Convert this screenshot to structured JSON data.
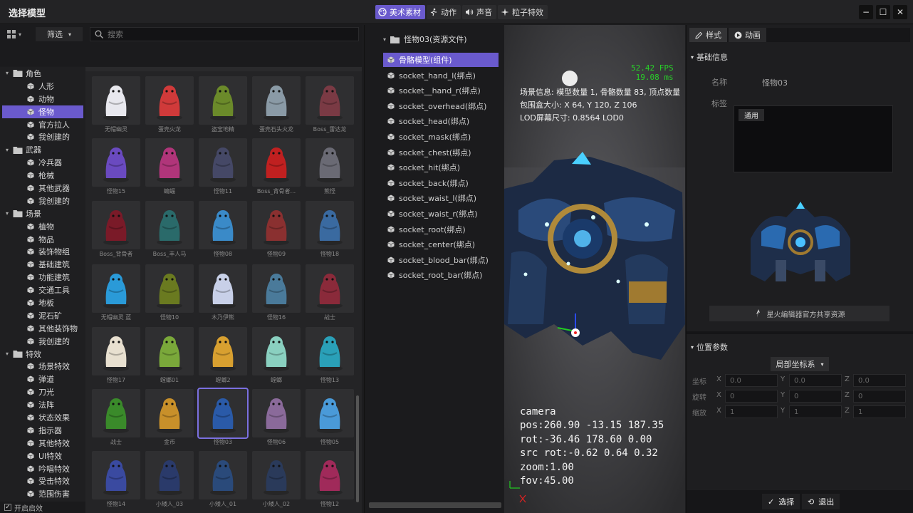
{
  "app": {
    "title": "选择模型"
  },
  "modes": [
    {
      "label": "美术素材",
      "icon": "palette-icon",
      "active": true
    },
    {
      "label": "动作",
      "icon": "running-icon",
      "active": false
    },
    {
      "label": "声音",
      "icon": "speaker-icon",
      "active": false
    },
    {
      "label": "粒子特效",
      "icon": "sparkle-icon",
      "active": false
    }
  ],
  "window_buttons": {
    "minimize": "−",
    "maximize": "☐",
    "close": "✕"
  },
  "toolbar": {
    "filter_label": "筛选",
    "search_placeholder": "搜索"
  },
  "tree": [
    {
      "label": "角色",
      "level": 0
    },
    {
      "label": "人形",
      "level": 1
    },
    {
      "label": "动物",
      "level": 1
    },
    {
      "label": "怪物",
      "level": 1,
      "selected": true
    },
    {
      "label": "官方拉人",
      "level": 1
    },
    {
      "label": "我创建的",
      "level": 1
    },
    {
      "label": "武器",
      "level": 0
    },
    {
      "label": "冷兵器",
      "level": 1
    },
    {
      "label": "枪械",
      "level": 1
    },
    {
      "label": "其他武器",
      "level": 1
    },
    {
      "label": "我创建的",
      "level": 1
    },
    {
      "label": "场景",
      "level": 0
    },
    {
      "label": "植物",
      "level": 1
    },
    {
      "label": "物品",
      "level": 1
    },
    {
      "label": "装饰物组",
      "level": 1
    },
    {
      "label": "基础建筑",
      "level": 1
    },
    {
      "label": "功能建筑",
      "level": 1
    },
    {
      "label": "交通工具",
      "level": 1
    },
    {
      "label": "地板",
      "level": 1
    },
    {
      "label": "泥石矿",
      "level": 1
    },
    {
      "label": "其他装饰物",
      "level": 1
    },
    {
      "label": "我创建的",
      "level": 1
    },
    {
      "label": "特效",
      "level": 0
    },
    {
      "label": "场景特效",
      "level": 1
    },
    {
      "label": "弹道",
      "level": 1
    },
    {
      "label": "刀光",
      "level": 1
    },
    {
      "label": "法阵",
      "level": 1
    },
    {
      "label": "状态效果",
      "level": 1
    },
    {
      "label": "指示器",
      "level": 1
    },
    {
      "label": "其他特效",
      "level": 1
    },
    {
      "label": "UI特效",
      "level": 1
    },
    {
      "label": "吟唱特效",
      "level": 1
    },
    {
      "label": "受击特效",
      "level": 1
    },
    {
      "label": "范围伤害",
      "level": 1
    }
  ],
  "startup": {
    "label": "开启启效",
    "checked": "✓"
  },
  "assets": [
    {
      "name": "无帽幽灵",
      "color": "#e8e8ee"
    },
    {
      "name": "蛋壳火龙",
      "color": "#d03a3a"
    },
    {
      "name": "盗宝地精",
      "color": "#6b8a2a"
    },
    {
      "name": "蛋壳石头火龙",
      "color": "#8a9aa6"
    },
    {
      "name": "Boss_雷达龙",
      "color": "#7a3a44"
    },
    {
      "name": "怪物15",
      "color": "#6a4ac0"
    },
    {
      "name": "蝙蝠",
      "color": "#b0357a"
    },
    {
      "name": "怪物11",
      "color": "#454866"
    },
    {
      "name": "Boss_背骨者...",
      "color": "#c02020"
    },
    {
      "name": "熊怪",
      "color": "#6a6a74"
    },
    {
      "name": "Boss_背骨者",
      "color": "#7a1a28"
    },
    {
      "name": "Boss_丰人马",
      "color": "#2a6a6a"
    },
    {
      "name": "怪物08",
      "color": "#3a8ac8"
    },
    {
      "name": "怪物09",
      "color": "#8a3030"
    },
    {
      "name": "怪物18",
      "color": "#3a6aa0"
    },
    {
      "name": "无帽幽灵 蓝",
      "color": "#2a9ad8"
    },
    {
      "name": "怪物10",
      "color": "#6a7a20"
    },
    {
      "name": "木乃伊熊",
      "color": "#c8d0e8"
    },
    {
      "name": "怪物16",
      "color": "#4a7a9a"
    },
    {
      "name": "战士",
      "color": "#8a2a3a"
    },
    {
      "name": "怪物17",
      "color": "#e8e0d0"
    },
    {
      "name": "螳螂01",
      "color": "#7aa83a"
    },
    {
      "name": "螳螂2",
      "color": "#d8a030"
    },
    {
      "name": "螳螂",
      "color": "#8ad0c0"
    },
    {
      "name": "怪物13",
      "color": "#2aa0b8"
    },
    {
      "name": "战士",
      "color": "#3a8a2a"
    },
    {
      "name": "金币",
      "color": "#c8902a"
    },
    {
      "name": "怪物03",
      "color": "#2a5aa8",
      "selected": true
    },
    {
      "name": "怪物06",
      "color": "#8a6a9a"
    },
    {
      "name": "怪物05",
      "color": "#4a9ad8"
    },
    {
      "name": "怪物14",
      "color": "#3a4aa0"
    },
    {
      "name": "小矮人_03",
      "color": "#2a3a6a"
    },
    {
      "name": "小矮人_01",
      "color": "#2a4a7a"
    },
    {
      "name": "小矮人_02",
      "color": "#2a3a5a"
    },
    {
      "name": "怪物12",
      "color": "#a02a5a"
    }
  ],
  "hierarchy": {
    "root": "怪物03(资源文件)",
    "items": [
      {
        "label": "骨骼模型(组件)",
        "selected": true
      },
      {
        "label": "socket_hand_l(绑点)"
      },
      {
        "label": "socket__hand_r(绑点)"
      },
      {
        "label": "socket_overhead(绑点)"
      },
      {
        "label": "socket_head(绑点)"
      },
      {
        "label": "socket_mask(绑点)"
      },
      {
        "label": "socket_chest(绑点)"
      },
      {
        "label": "socket_hit(绑点)"
      },
      {
        "label": "socket_back(绑点)"
      },
      {
        "label": "socket_waist_l(绑点)"
      },
      {
        "label": "socket_waist_r(绑点)"
      },
      {
        "label": "socket_root(绑点)"
      },
      {
        "label": "socket_center(绑点)"
      },
      {
        "label": "socket_blood_bar(绑点)"
      },
      {
        "label": "socket_root_bar(绑点)"
      }
    ]
  },
  "viewport": {
    "fps": "52.42 FPS",
    "ms": "19.08 ms",
    "scene_info": "场景信息: 模型数量 1, 骨骼数量 83, 顶点数量",
    "bbox": "包围盒大小: X 64, Y 120, Z 106",
    "lod": "LOD屏幕尺寸: 0.8564     LOD0",
    "camera": "camera",
    "pos": "pos:260.90 -13.15 187.35",
    "rot": "rot:-36.46 178.60 0.00",
    "src_rot": "src rot:-0.62 0.64 0.32",
    "zoom": "zoom:1.00",
    "fov": "fov:45.00"
  },
  "inspector": {
    "tabs": [
      {
        "label": "样式",
        "icon": "pencil-icon",
        "active": true
      },
      {
        "label": "动画",
        "icon": "play-icon",
        "active": false
      }
    ],
    "basic_info_title": "基础信息",
    "name_label": "名称",
    "name_value": "怪物03",
    "tag_label": "标签",
    "tag_value": "通用",
    "share_label": "星火编辑器官方共享资源",
    "position_title": "位置参数",
    "coord_system": "局部坐标系",
    "rows": [
      {
        "label": "坐标",
        "x": "0.0",
        "y": "0.0",
        "z": "0.0"
      },
      {
        "label": "旋转",
        "x": "0",
        "y": "0",
        "z": "0"
      },
      {
        "label": "缩放",
        "x": "1",
        "y": "1",
        "z": "1"
      }
    ],
    "axis_x": "X",
    "axis_y": "Y",
    "axis_z": "Z",
    "select_label": "选择",
    "exit_label": "退出"
  },
  "colors": {
    "accent": "#6a5acd",
    "fps": "#28d028"
  }
}
